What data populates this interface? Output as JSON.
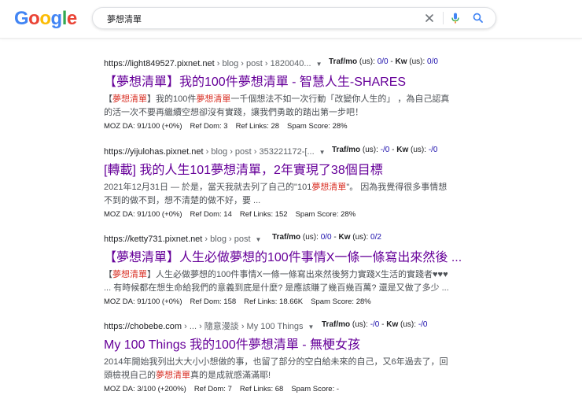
{
  "search": {
    "query": "夢想清單"
  },
  "colors": {
    "title_visited": "#660099",
    "highlight": "#d93025",
    "metric_blue": "#1a0dab"
  },
  "results": [
    {
      "host": "https://light849527.pixnet.net",
      "path": " › blog › post › 1820040...",
      "metric_label_traf": "Traf/mo",
      "metric_traf_unit": "(us):",
      "metric_traf_value": "0/0",
      "metric_label_kw": "Kw",
      "metric_kw_unit": "(us):",
      "metric_kw_value": "0/0",
      "title": "【夢想清單】我的100件夢想清單 - 智慧人生-SHARES",
      "snippet_parts": [
        "【",
        "夢想清單",
        "】我的100件",
        "夢想清單",
        "一千個想法不如一次行動「改變你人生的」 ，為自己認真的活一次不要再繼續空想卻沒有實踐，讓我們勇敢的踏出第一步吧！"
      ],
      "moz_da": "MOZ DA: 91/100 (+0%)",
      "ref_dom": "Ref Dom: 3",
      "ref_links": "Ref Links: 28",
      "spam": "Spam Score: 28%"
    },
    {
      "host": "https://yijulohas.pixnet.net",
      "path": " › blog › post › 353221172-[...",
      "metric_label_traf": "Traf/mo",
      "metric_traf_unit": "(us):",
      "metric_traf_value": "-/0",
      "metric_label_kw": "Kw",
      "metric_kw_unit": "(us):",
      "metric_kw_value": "-/0",
      "title": "[轉載] 我的人生101夢想清單，2年實現了38個目標",
      "snippet_parts": [
        "2021年12月31日 — 於是，當天我就去列了自己的\"101",
        "夢想清單",
        "\"。 因為我覺得很多事情想不到的做不到，想不清楚的做不好，要 ..."
      ],
      "moz_da": "MOZ DA: 91/100 (+0%)",
      "ref_dom": "Ref Dom: 14",
      "ref_links": "Ref Links: 152",
      "spam": "Spam Score: 28%"
    },
    {
      "host": "https://ketty731.pixnet.net",
      "path": " › blog › post",
      "metric_label_traf": "Traf/mo",
      "metric_traf_unit": "(us):",
      "metric_traf_value": "0/0",
      "metric_label_kw": "Kw",
      "metric_kw_unit": "(us):",
      "metric_kw_value": "0/2",
      "title": "【夢想清單】人生必做夢想的100件事情X一條一條寫出來然後 ...",
      "snippet_parts": [
        "【",
        "夢想清單",
        "】人生必做夢想的100件事情X一條一條寫出來然後努力實踐X生活的實踐者♥♥♥ ... 有時候都在想生命給我們的意義到底是什麼? 是應該賺了幾百幾百萬? 還是又做了多少 ..."
      ],
      "moz_da": "MOZ DA: 91/100 (+0%)",
      "ref_dom": "Ref Dom: 158",
      "ref_links": "Ref Links: 18.66K",
      "spam": "Spam Score: 28%"
    },
    {
      "host": "https://chobebe.com",
      "path": " › ... › 隨意漫談 › My 100 Things",
      "metric_label_traf": "Traf/mo",
      "metric_traf_unit": "(us):",
      "metric_traf_value": "-/0",
      "metric_label_kw": "Kw",
      "metric_kw_unit": "(us):",
      "metric_kw_value": "-/0",
      "title": "My 100 Things 我的100件夢想清單 - 無梗女孩",
      "snippet_parts": [
        "2014年開始我列出大大小小想做的事，也留了部分的空白給未來的自己，又6年過去了，回頭檢視自己的",
        "夢想清單",
        "真的是成就感滿滿耶!"
      ],
      "moz_da": "MOZ DA: 3/100 (+200%)",
      "ref_dom": "Ref Dom: 7",
      "ref_links": "Ref Links: 68",
      "spam": "Spam Score: -"
    }
  ]
}
